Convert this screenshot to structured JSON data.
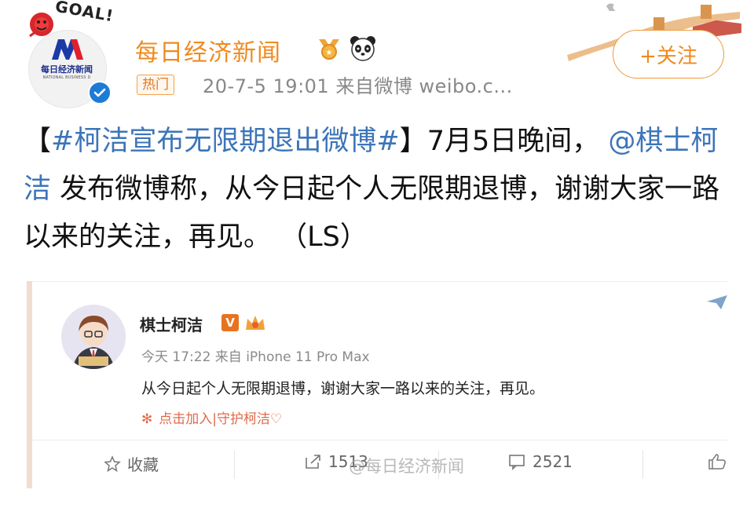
{
  "header": {
    "avatar_sticker": "GOAL!",
    "avatar_logo_cn": "每日经济新闻",
    "avatar_logo_en": "NATIONAL BUSINESS D",
    "username": "每日经济新闻",
    "hot_tag": "热门",
    "meta": "20-7-5 19:01  来自微博 weibo.c...",
    "follow_label": "+关注"
  },
  "post": {
    "bracket_open": "【",
    "topic": "#柯洁宣布无限期退出微博#",
    "bracket_close": "】",
    "text_a": "7月5日晚间，",
    "mention": "@棋士柯洁",
    "text_b": " 发布微博称，从今日起个人无限期退博，谢谢大家一路以来的关注，再见。  （LS）"
  },
  "embedded": {
    "name": "棋士柯洁",
    "v_badge": "V",
    "meta": "今天 17:22 来自 iPhone 11 Pro Max",
    "text": "从今日起个人无限期退博，谢谢大家一路以来的关注，再见。",
    "fan_link": "点击加入|守护柯洁♡",
    "actions": {
      "favorite": "收藏",
      "repost_count": "1513",
      "comment_count": "2521"
    },
    "watermark": "@每日经济新闻"
  },
  "colors": {
    "username": "#f08a1e",
    "link": "#3c75b8",
    "meta_gray": "#888888"
  }
}
